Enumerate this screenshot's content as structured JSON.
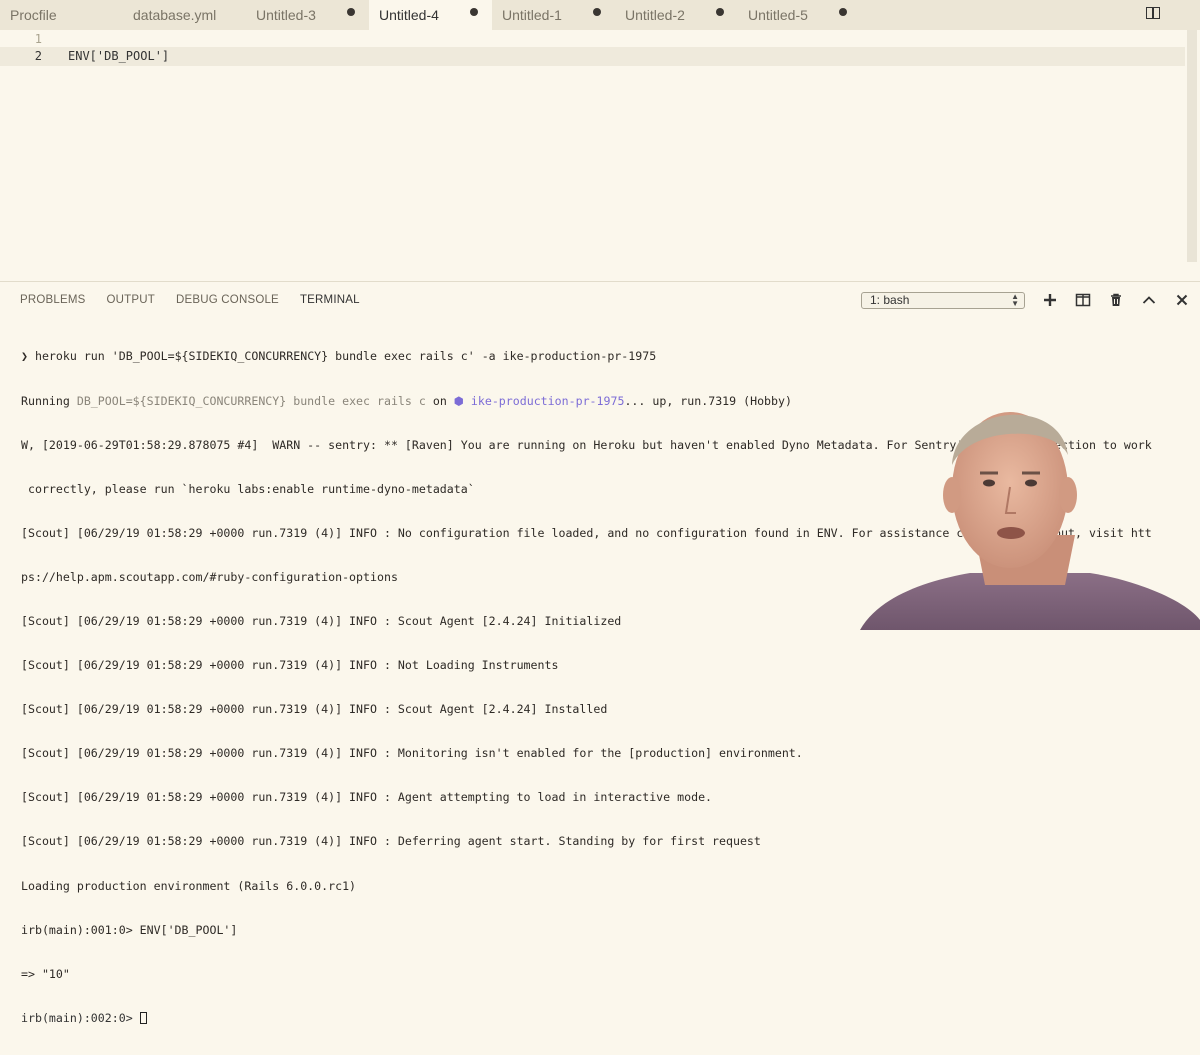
{
  "tabs": [
    {
      "label": "Procfile",
      "active": false,
      "dirty": false
    },
    {
      "label": "database.yml",
      "active": false,
      "dirty": false
    },
    {
      "label": "Untitled-3",
      "active": false,
      "dirty": true
    },
    {
      "label": "Untitled-4",
      "active": true,
      "dirty": true
    },
    {
      "label": "Untitled-1",
      "active": false,
      "dirty": true
    },
    {
      "label": "Untitled-2",
      "active": false,
      "dirty": true
    },
    {
      "label": "Untitled-5",
      "active": false,
      "dirty": true
    }
  ],
  "editor": {
    "lines": [
      {
        "number": "1",
        "text": ""
      },
      {
        "number": "2",
        "text": "ENV['DB_POOL']"
      }
    ]
  },
  "panel": {
    "tabs": [
      "PROBLEMS",
      "OUTPUT",
      "DEBUG CONSOLE",
      "TERMINAL"
    ],
    "active_tab": "TERMINAL",
    "terminal_select": "1: bash",
    "icons": [
      "plus-icon",
      "split-terminal-icon",
      "trash-icon",
      "chevron-up-icon",
      "close-icon"
    ]
  },
  "terminal": {
    "cmd_prefix": "❯ ",
    "cmd": "heroku run 'DB_POOL=${SIDEKIQ_CONCURRENCY} bundle exec rails c' -a ike-production-pr-1975",
    "running": {
      "word": "Running ",
      "command": "DB_POOL=${SIDEKIQ_CONCURRENCY} bundle exec rails c",
      "on": " on ",
      "app_icon": "⬢",
      "app": " ike-production-pr-1975",
      "status": "... up, run.7319 (Hobby)"
    },
    "warn_1": "W, [2019-06-29T01:58:29.878075 #4]  WARN -- sentry: ** [Raven] You are running on Heroku but haven't enabled Dyno Metadata. For Sentry's release detection to work",
    "warn_2": " correctly, please run `heroku labs:enable runtime-dyno-metadata`",
    "scout_1": "[Scout] [06/29/19 01:58:29 +0000 run.7319 (4)] INFO : No configuration file loaded, and no configuration found in ENV. For assistance configuring Scout, visit htt",
    "scout_1b": "ps://help.apm.scoutapp.com/#ruby-configuration-options",
    "scout_2": "[Scout] [06/29/19 01:58:29 +0000 run.7319 (4)] INFO : Scout Agent [2.4.24] Initialized",
    "scout_3": "[Scout] [06/29/19 01:58:29 +0000 run.7319 (4)] INFO : Not Loading Instruments",
    "scout_4": "[Scout] [06/29/19 01:58:29 +0000 run.7319 (4)] INFO : Scout Agent [2.4.24] Installed",
    "scout_5": "[Scout] [06/29/19 01:58:29 +0000 run.7319 (4)] INFO : Monitoring isn't enabled for the [production] environment.",
    "scout_6": "[Scout] [06/29/19 01:58:29 +0000 run.7319 (4)] INFO : Agent attempting to load in interactive mode.",
    "scout_7": "[Scout] [06/29/19 01:58:29 +0000 run.7319 (4)] INFO : Deferring agent start. Standing by for first request",
    "loading": "Loading production environment (Rails 6.0.0.rc1)",
    "irb_1": "irb(main):001:0> ENV['DB_POOL']",
    "result": "=> \"10\"",
    "irb_2": "irb(main):002:0> "
  },
  "colors": {
    "background": "#fbf7ec",
    "tabbar": "#ece6d6",
    "accent_purple": "#7c6cd6"
  }
}
